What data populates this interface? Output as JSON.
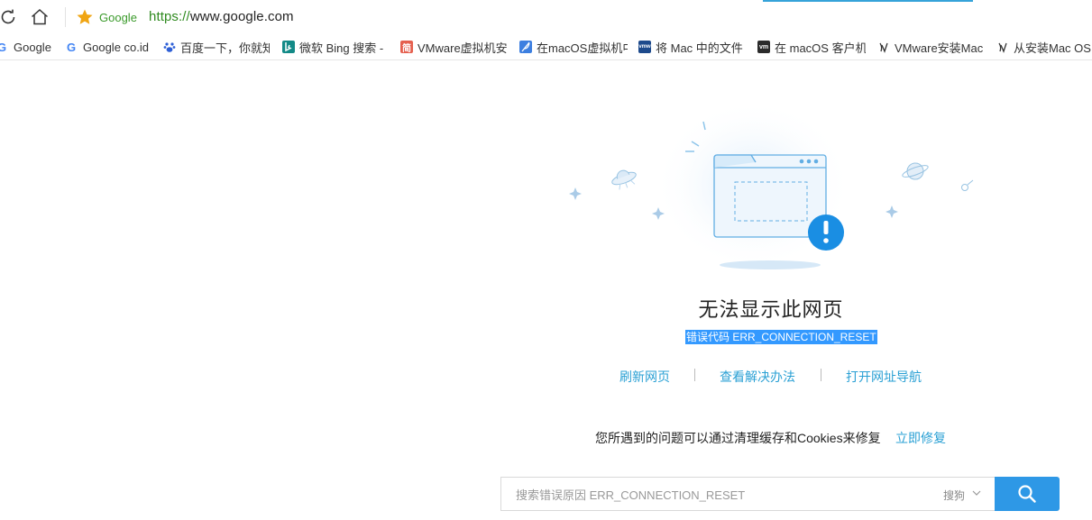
{
  "address_bar": {
    "site_label": "Google",
    "url_scheme": "https://",
    "url_rest": "www.google.com"
  },
  "bookmarks": [
    {
      "label": "Google",
      "icon": "google-g-icon"
    },
    {
      "label": "Google co.id",
      "icon": "google-g-icon"
    },
    {
      "label": "百度一下，你就知",
      "icon": "baidu-paw-icon"
    },
    {
      "label": "微软 Bing 搜索 -",
      "icon": "bing-icon"
    },
    {
      "label": "VMware虚拟机安",
      "icon": "jianshu-icon",
      "icon_text": "简"
    },
    {
      "label": "在macOS虚拟机中",
      "icon": "feather-icon"
    },
    {
      "label": "将 Mac 中的文件",
      "icon": "vmware-icon",
      "icon_text": "vmw"
    },
    {
      "label": "在 macOS 客户机",
      "icon": "vm-icon",
      "icon_text": "vm"
    },
    {
      "label": "VMware安装Mac",
      "icon": "csdn-icon"
    },
    {
      "label": "从安装Mac OS",
      "icon": "csdn-icon"
    }
  ],
  "error": {
    "title": "无法显示此网页",
    "code_text": "错误代码 ERR_CONNECTION_RESET"
  },
  "actions": {
    "refresh": "刷新网页",
    "solutions": "查看解决办法",
    "nav": "打开网址导航"
  },
  "fix": {
    "text": "您所遇到的问题可以通过清理缓存和Cookies来修复",
    "link": "立即修复"
  },
  "search": {
    "placeholder": "搜索错误原因 ERR_CONNECTION_RESET",
    "engine": "搜狗"
  },
  "colors": {
    "accent_blue": "#2e98e6",
    "link_blue": "#2aa0d4",
    "selection_blue": "#3399ff",
    "site_green": "#3a9a2a"
  }
}
